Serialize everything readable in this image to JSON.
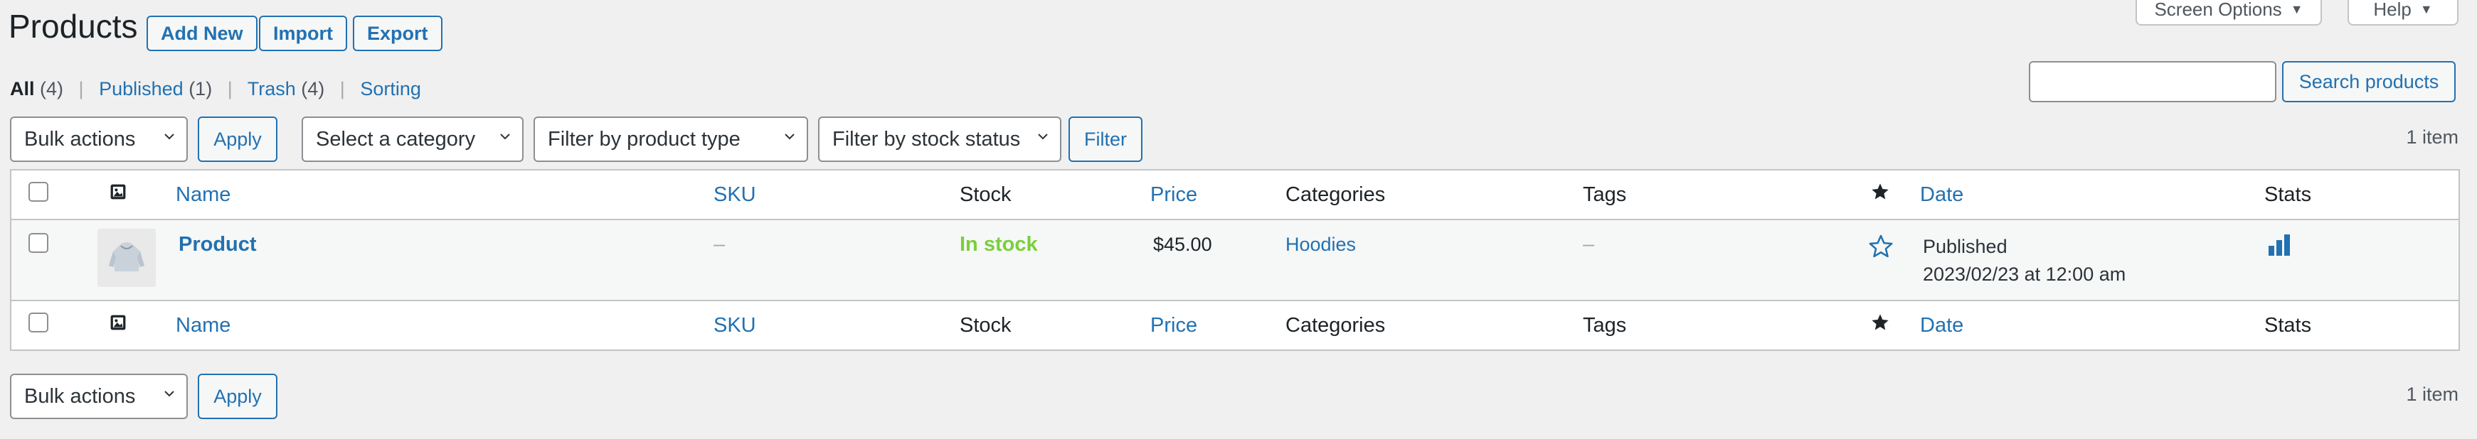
{
  "header": {
    "title": "Products",
    "add_new": "Add New",
    "import": "Import",
    "export": "Export",
    "screen_options": "Screen Options",
    "help": "Help"
  },
  "views": {
    "all": {
      "label": "All",
      "count": "(4)"
    },
    "published": {
      "label": "Published",
      "count": "(1)"
    },
    "trash": {
      "label": "Trash",
      "count": "(4)"
    },
    "sorting": {
      "label": "Sorting"
    },
    "separator": "|"
  },
  "search": {
    "value": "",
    "button": "Search products"
  },
  "filters": {
    "bulk_actions": "Bulk actions",
    "apply": "Apply",
    "category": "Select a category",
    "product_type": "Filter by product type",
    "stock_status": "Filter by stock status",
    "filter": "Filter"
  },
  "pagination": {
    "top_count": "1 item",
    "bottom_count": "1 item"
  },
  "columns": {
    "name": "Name",
    "sku": "SKU",
    "stock": "Stock",
    "price": "Price",
    "categories": "Categories",
    "tags": "Tags",
    "date": "Date",
    "stats": "Stats"
  },
  "rows": [
    {
      "name": "Product",
      "sku": "–",
      "stock": "In stock",
      "price": "$45.00",
      "category": "Hoodies",
      "tags": "–",
      "featured": false,
      "date_status": "Published",
      "date_value": "2023/02/23 at 12:00 am"
    }
  ],
  "icons": {
    "chevron": "chevron-down-icon",
    "image": "image-icon",
    "featured_header": "star-filled-icon",
    "featured_row": "star-outline-icon",
    "stats": "bar-chart-icon"
  },
  "colors": {
    "accent": "#2271b1",
    "in_stock": "#7ad03a",
    "background": "#f0f0f1"
  }
}
